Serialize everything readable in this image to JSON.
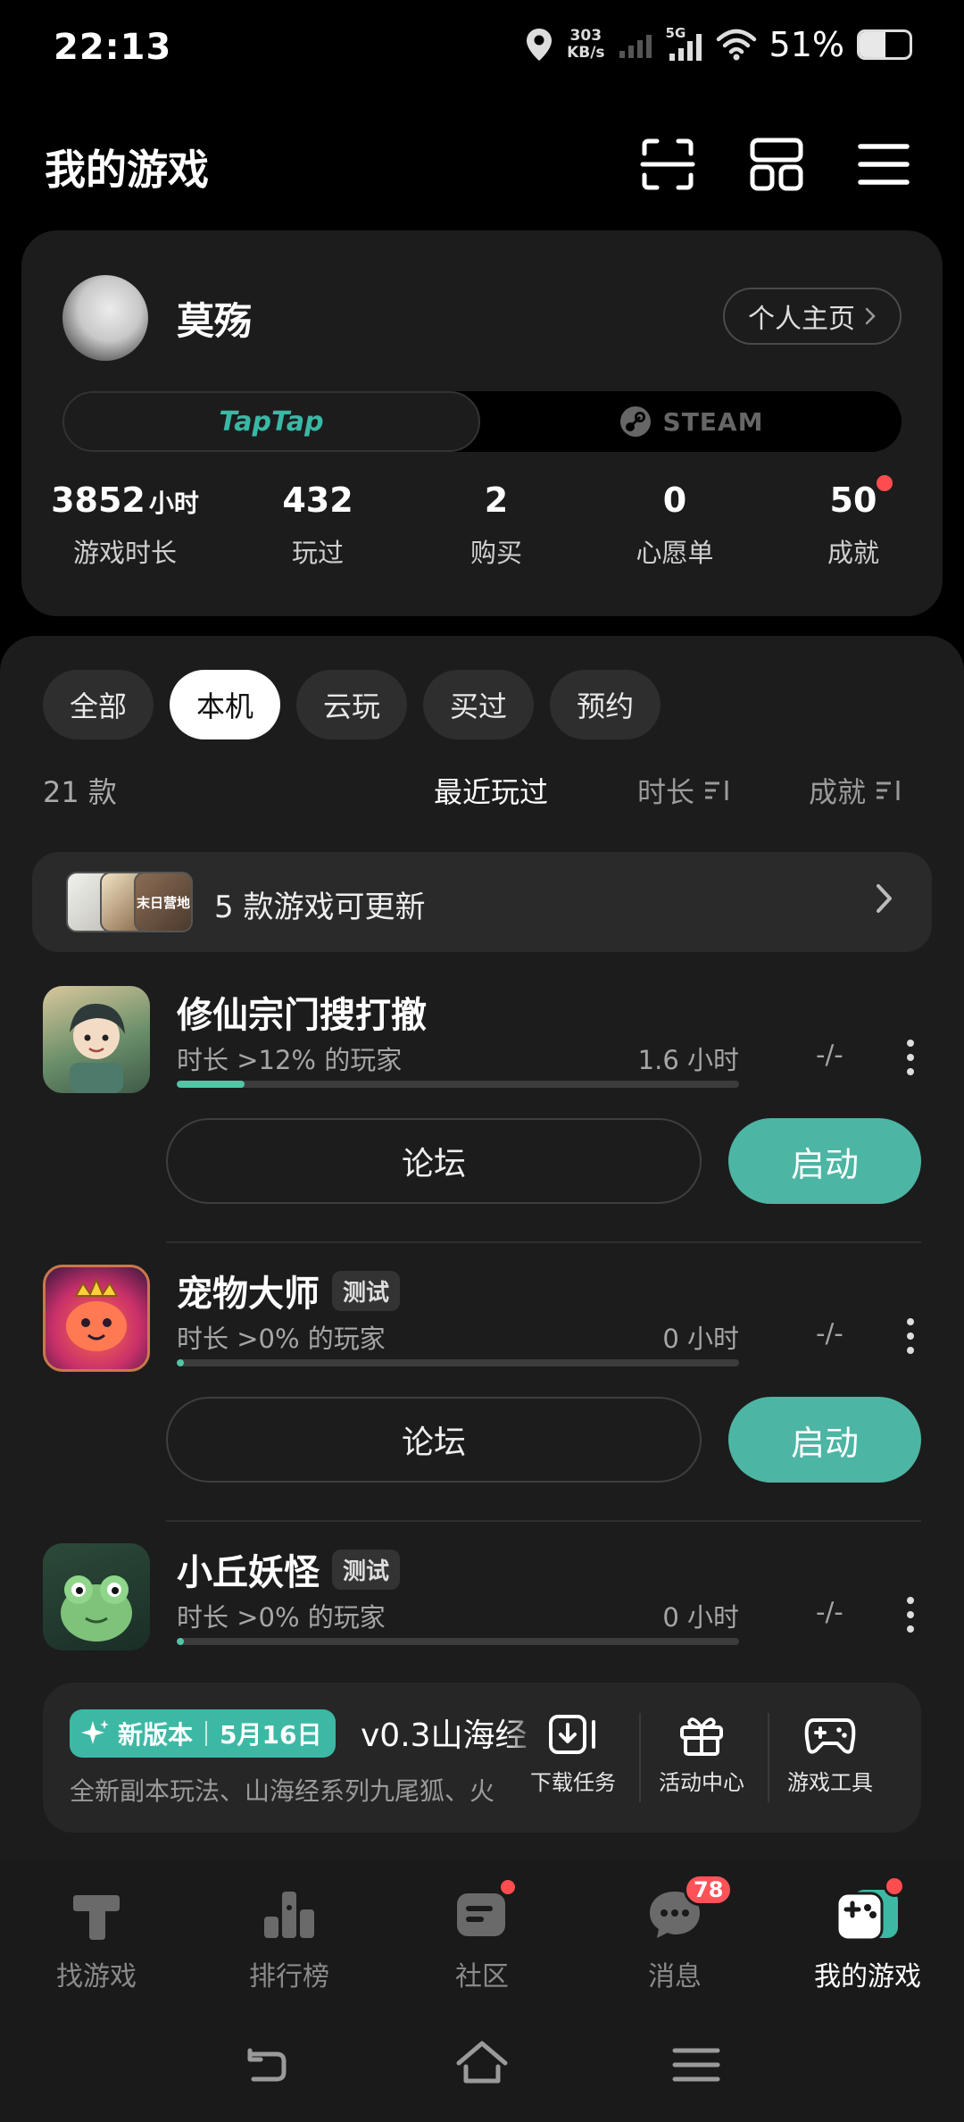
{
  "status_bar": {
    "time": "22:13",
    "net_speed_value": "303",
    "net_speed_unit": "KB/s",
    "network": "5G",
    "battery_percent": "51%",
    "battery_level": 0.51
  },
  "header": {
    "title": "我的游戏",
    "icons": [
      "scan-icon",
      "grid-icon",
      "menu-icon"
    ]
  },
  "profile": {
    "username": "莫殇",
    "profile_link": "个人主页",
    "platforms": {
      "taptap": "TapTap",
      "steam": "STEAM",
      "selected": "TapTap"
    },
    "stats": [
      {
        "value": "3852",
        "unit": "小时",
        "label": "游戏时长"
      },
      {
        "value": "432",
        "unit": "",
        "label": "玩过"
      },
      {
        "value": "2",
        "unit": "",
        "label": "购买"
      },
      {
        "value": "0",
        "unit": "",
        "label": "心愿单"
      },
      {
        "value": "50",
        "unit": "",
        "label": "成就"
      }
    ]
  },
  "filters": {
    "chips": [
      "全部",
      "本机",
      "云玩",
      "买过",
      "预约"
    ],
    "active": "本机"
  },
  "sort": {
    "count": "21 款",
    "options": [
      "最近玩过",
      "时长",
      "成就"
    ],
    "active": "最近玩过"
  },
  "update_banner": {
    "text": "5 款游戏可更新",
    "icon_text": "末日营地"
  },
  "games": [
    {
      "name": "修仙宗门搜打撤",
      "badge": "",
      "meta": "时长 >12% 的玩家",
      "hours": "1.6 小时",
      "progress": 0.12,
      "achievement": "-/-",
      "forum_label": "论坛",
      "launch_label": "启动"
    },
    {
      "name": "宠物大师",
      "badge": "测试",
      "meta": "时长 >0% 的玩家",
      "hours": "0 小时",
      "progress": 0.0,
      "achievement": "-/-",
      "forum_label": "论坛",
      "launch_label": "启动"
    },
    {
      "name": "小丘妖怪",
      "badge": "测试",
      "meta": "时长 >0% 的玩家",
      "hours": "0 小时",
      "progress": 0.0,
      "achievement": "-/-"
    }
  ],
  "version_strip": {
    "badge_label": "新版本",
    "badge_date": "5月16日",
    "title": "v0.3山海经",
    "description": "全新副本玩法、山海经系列九尾狐、火",
    "actions": [
      "下载任务",
      "活动中心",
      "游戏工具"
    ]
  },
  "bottom_nav": {
    "items": [
      "找游戏",
      "排行榜",
      "社区",
      "消息",
      "我的游戏"
    ],
    "active": "我的游戏",
    "message_badge": "78"
  },
  "colors": {
    "accent": "#4db5a4",
    "badge_red": "#ff4d4f",
    "background": "#000000",
    "card": "#1c1c1c"
  }
}
